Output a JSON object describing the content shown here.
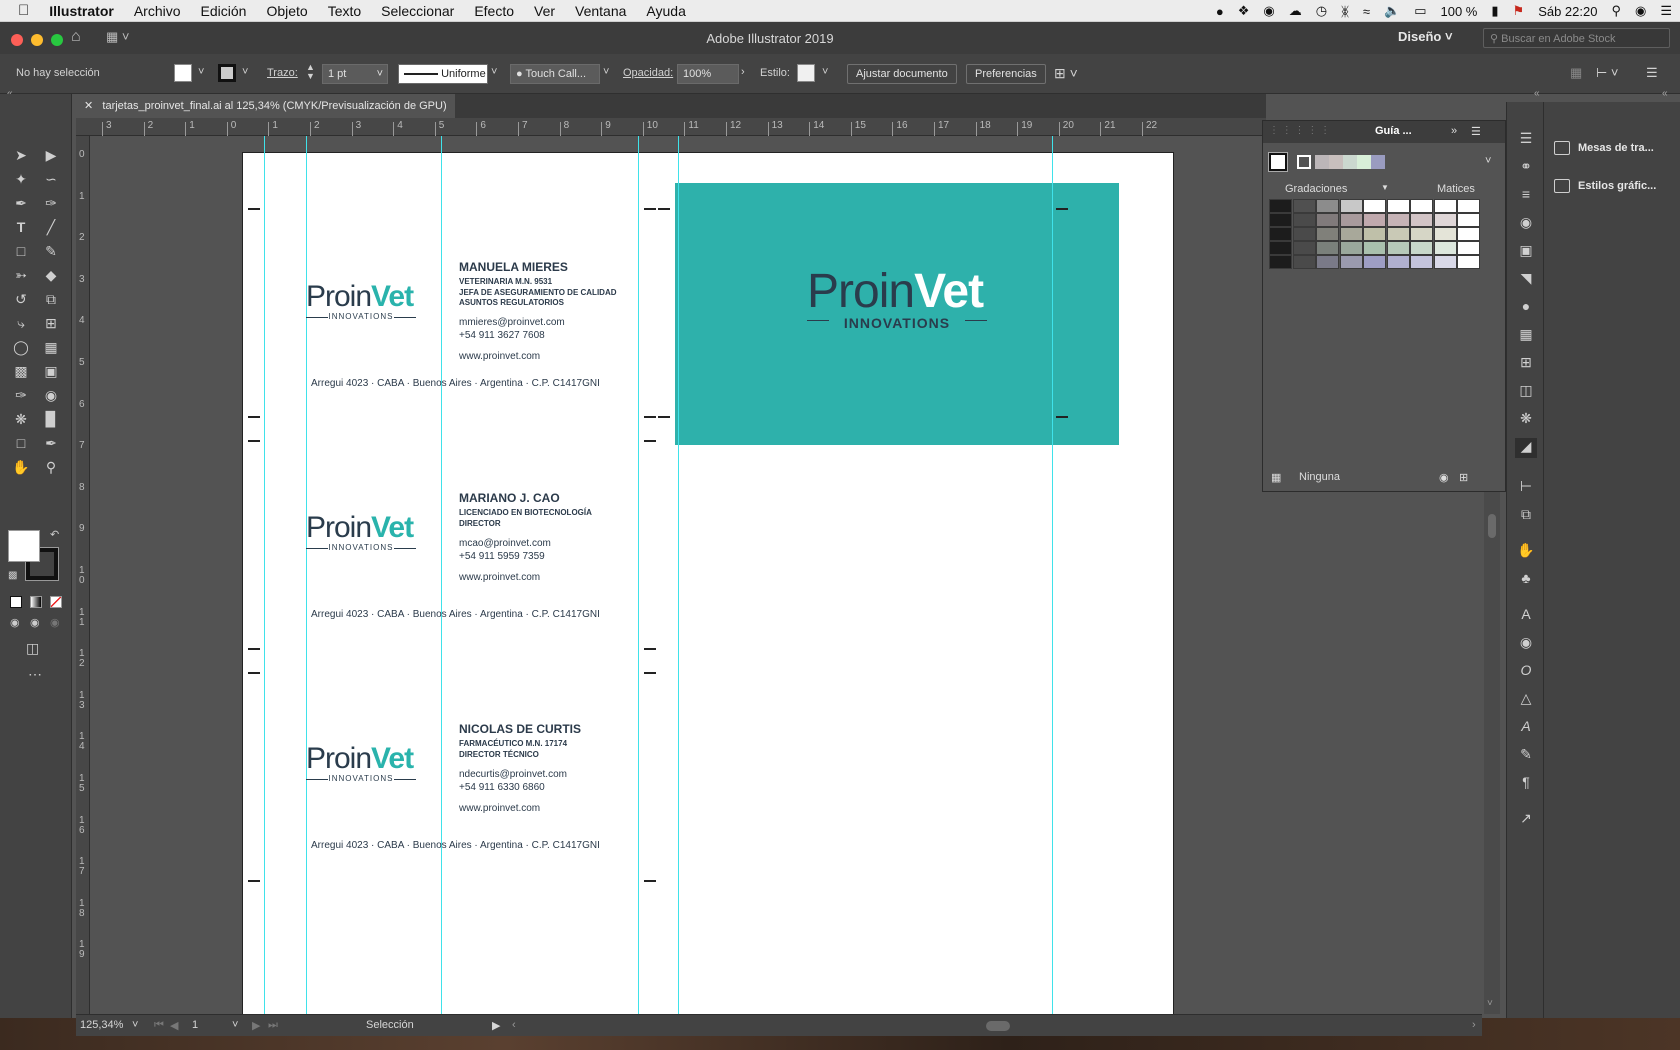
{
  "menubar": {
    "items": [
      "Illustrator",
      "Archivo",
      "Edición",
      "Objeto",
      "Texto",
      "Seleccionar",
      "Efecto",
      "Ver",
      "Ventana",
      "Ayuda"
    ],
    "battery": "100 %",
    "clock": "Sáb 22:20"
  },
  "titlebar": {
    "title": "Adobe Illustrator 2019",
    "workspace": "Diseño",
    "search_placeholder": "Buscar en Adobe Stock"
  },
  "control": {
    "selection": "No hay selección",
    "stroke_label": "Trazo:",
    "stroke_value": "1 pt",
    "profile": "Uniforme",
    "brush": "Touch Call...",
    "opacity_label": "Opacidad:",
    "opacity_value": "100%",
    "style_label": "Estilo:",
    "fit_document": "Ajustar documento",
    "preferences": "Preferencias"
  },
  "tab": {
    "title": "tarjetas_proinvet_final.ai al 125,34% (CMYK/Previsualización de GPU)"
  },
  "ruler": {
    "h_ticks": [
      "3",
      "2",
      "1",
      "0",
      "1",
      "2",
      "3",
      "4",
      "5",
      "6",
      "7",
      "8",
      "9",
      "10",
      "11",
      "12",
      "13",
      "14",
      "15",
      "16",
      "17",
      "18",
      "19",
      "20",
      "21",
      "22"
    ],
    "v_ticks": [
      "0",
      "1",
      "2",
      "3",
      "4",
      "5",
      "6",
      "7",
      "8",
      "9",
      "1\n0",
      "1\n1",
      "1\n2",
      "1\n3",
      "1\n4",
      "1\n5",
      "1\n6",
      "1\n7",
      "1\n8",
      "1\n9"
    ]
  },
  "cards": [
    {
      "name": "MANUELA MIERES",
      "sub": [
        "VETERINARIA M.N. 9531",
        "JEFA DE ASEGURAMIENTO DE CALIDAD",
        "ASUNTOS REGULATORIOS"
      ],
      "email": "mmieres@proinvet.com",
      "phone": "+54 911 3627 7608",
      "web": "www.proinvet.com",
      "address": "Arregui 4023 · CABA · Buenos Aires · Argentina  · C.P. C1417GNI"
    },
    {
      "name": "MARIANO J. CAO",
      "sub": [
        "LICENCIADO EN BIOTECNOLOGÍA",
        "DIRECTOR"
      ],
      "email": "mcao@proinvet.com",
      "phone": "+54 911 5959 7359",
      "web": "www.proinvet.com",
      "address": "Arregui 4023 · CABA · Buenos Aires · Argentina  · C.P. C1417GNI"
    },
    {
      "name": "NICOLAS DE CURTIS",
      "sub": [
        "FARMACÉUTICO M.N. 17174",
        "DIRECTOR TÉCNICO"
      ],
      "email": "ndecurtis@proinvet.com",
      "phone": "+54 911 6330 6860",
      "web": "www.proinvet.com",
      "address": "Arregui 4023 · CABA · Buenos Aires · Argentina  · C.P. C1417GNI"
    }
  ],
  "logo": {
    "part1": "Proin",
    "part2": "Vet",
    "tagline": "INNOVATIONS",
    "teal": "#2eb1ab",
    "navy": "#2a3c4c"
  },
  "swatches_panel": {
    "tab": "Guía ...",
    "gradients": "Gradaciones",
    "matices": "Matices",
    "none": "Ninguna"
  },
  "right_panel": {
    "artboards": "Mesas de tra...",
    "graphic_styles": "Estilos gráfic..."
  },
  "status": {
    "zoom": "125,34%",
    "artboard": "1",
    "tool": "Selección"
  }
}
